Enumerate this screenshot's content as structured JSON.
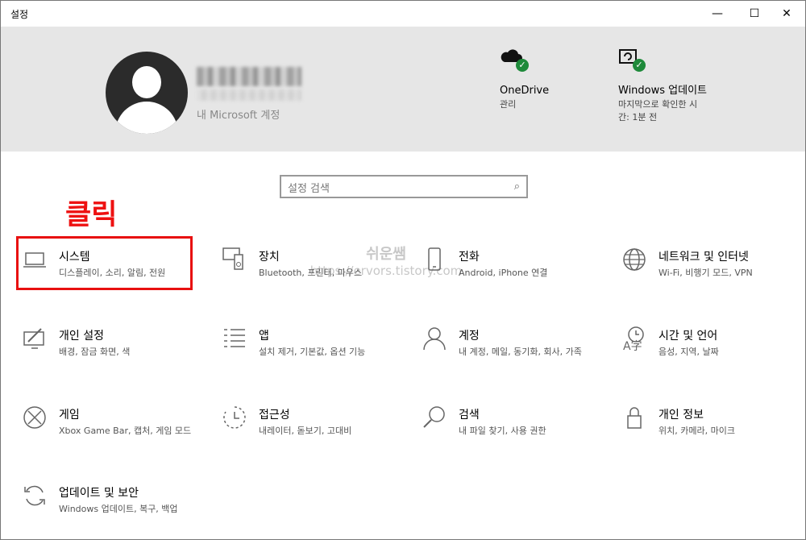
{
  "window": {
    "title": "설정"
  },
  "titlebar": {
    "minimize": "—",
    "maximize": "☐",
    "close": "✕"
  },
  "header": {
    "account_link": "내 Microsoft 계정",
    "onedrive": {
      "title": "OneDrive",
      "subtitle": "관리"
    },
    "update": {
      "title": "Windows 업데이트",
      "subtitle": "마지막으로 확인한 시간: 1분 전"
    }
  },
  "search": {
    "placeholder": "설정 검색"
  },
  "annotation": {
    "click_label": "클릭"
  },
  "watermark": {
    "line1": "쉬운쌤",
    "line2": "https://ervors.tistory.com"
  },
  "tiles": [
    {
      "name": "시스템",
      "desc": "디스플레이, 소리, 알림, 전원",
      "icon": "laptop-icon"
    },
    {
      "name": "장치",
      "desc": "Bluetooth, 프린터, 마우스",
      "icon": "keyboard-device-icon"
    },
    {
      "name": "전화",
      "desc": "Android, iPhone 연결",
      "icon": "phone-icon"
    },
    {
      "name": "네트워크 및 인터넷",
      "desc": "Wi-Fi, 비행기 모드, VPN",
      "icon": "globe-icon"
    },
    {
      "name": "개인 설정",
      "desc": "배경, 잠금 화면, 색",
      "icon": "paint-brush-icon"
    },
    {
      "name": "앱",
      "desc": "설치 제거, 기본값, 옵션 기능",
      "icon": "apps-list-icon"
    },
    {
      "name": "계정",
      "desc": "내 계정, 메일, 동기화, 회사, 가족",
      "icon": "person-icon"
    },
    {
      "name": "시간 및 언어",
      "desc": "음성, 지역, 날짜",
      "icon": "time-language-icon"
    },
    {
      "name": "게임",
      "desc": "Xbox Game Bar, 캡처, 게임 모드",
      "icon": "xbox-icon"
    },
    {
      "name": "접근성",
      "desc": "내레이터, 돋보기, 고대비",
      "icon": "ease-of-access-icon"
    },
    {
      "name": "검색",
      "desc": "내 파일 찾기, 사용 권한",
      "icon": "search-icon"
    },
    {
      "name": "개인 정보",
      "desc": "위치, 카메라, 마이크",
      "icon": "lock-icon"
    },
    {
      "name": "업데이트 및 보안",
      "desc": "Windows 업데이트, 복구, 백업",
      "icon": "sync-icon"
    }
  ],
  "colors": {
    "header_bg": "#e6e6e6",
    "annotation_red": "#ee1111",
    "status_green": "#1e8a3a"
  }
}
